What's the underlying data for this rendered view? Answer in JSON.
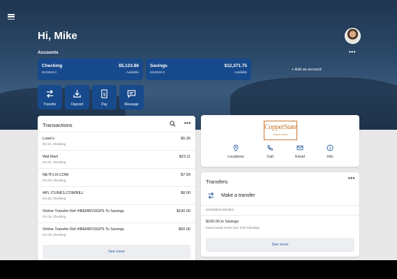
{
  "header": {
    "greeting": "Hi, Mike"
  },
  "accounts": {
    "label": "Accounts",
    "more": "•••",
    "cards": [
      {
        "name": "Checking",
        "balance": "$5,123.86",
        "number": "6110634-2",
        "status": "Available"
      },
      {
        "name": "Savings",
        "balance": "$12,371.75",
        "number": "6110634-3",
        "status": "Available"
      }
    ],
    "add_label": "+ Add an account"
  },
  "actions": [
    {
      "label": "Transfer",
      "icon": "transfer-icon"
    },
    {
      "label": "Deposit",
      "icon": "deposit-icon"
    },
    {
      "label": "Pay",
      "icon": "pay-icon"
    },
    {
      "label": "Message",
      "icon": "message-icon"
    }
  ],
  "transactions": {
    "title": "Transactions",
    "more": "•••",
    "rows": [
      {
        "desc": "Lowe's",
        "date": "Oct 21, Checking",
        "amount": "$5.35"
      },
      {
        "desc": "Wal-Mart",
        "date": "Oct 21, Checking",
        "amount": "$23.11"
      },
      {
        "desc": "NETFLIX.COM",
        "date": "Oct 20, Checking",
        "amount": "$7.99"
      },
      {
        "desc": "APL ITUNES.COM/BILL",
        "date": "Oct 20, Checking",
        "amount": "$8.00"
      },
      {
        "desc": "Online Transfer Ref #IBEMRVSGPS To Savings",
        "date": "Oct 19, Checking",
        "amount": "$100.00"
      },
      {
        "desc": "Online Transfer Ref #IBEMRVSGPS To Savings",
        "date": "Oct 19, Checking",
        "amount": "$50.00"
      }
    ],
    "see_more": "See more"
  },
  "bank": {
    "logo_text": "CopperState",
    "logo_sub": "CREDIT UNION",
    "buttons": [
      {
        "label": "Locations",
        "icon": "location-pin-icon"
      },
      {
        "label": "Call",
        "icon": "phone-icon"
      },
      {
        "label": "Email",
        "icon": "email-icon"
      },
      {
        "label": "Info",
        "icon": "info-icon"
      }
    ]
  },
  "transfers": {
    "title": "Transfers",
    "more": "•••",
    "make_transfer": "Make a transfer",
    "scheduled_label": "Scheduled transfers",
    "scheduled_item": "$100.00 to Savings",
    "scheduled_detail": "Every month on the 21st, from Checking",
    "see_more": "See more"
  },
  "colors": {
    "primary": "#174a8c",
    "link": "#2a5d9f",
    "brand": "#c9772f"
  }
}
